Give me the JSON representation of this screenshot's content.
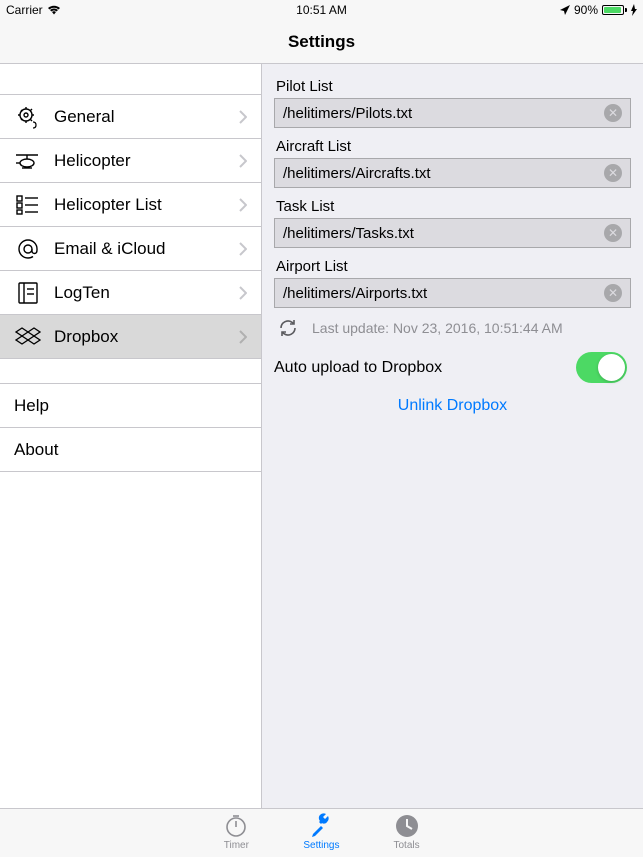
{
  "status": {
    "carrier": "Carrier",
    "time": "10:51 AM",
    "battery": "90%"
  },
  "nav": {
    "title": "Settings"
  },
  "sidebar": {
    "items": [
      {
        "label": "General"
      },
      {
        "label": "Helicopter"
      },
      {
        "label": "Helicopter List"
      },
      {
        "label": "Email & iCloud"
      },
      {
        "label": "LogTen"
      },
      {
        "label": "Dropbox"
      }
    ],
    "items2": [
      {
        "label": "Help"
      },
      {
        "label": "About"
      }
    ]
  },
  "detail": {
    "fields": [
      {
        "label": "Pilot List",
        "value": "/helitimers/Pilots.txt"
      },
      {
        "label": "Aircraft List",
        "value": "/helitimers/Aircrafts.txt"
      },
      {
        "label": "Task List",
        "value": "/helitimers/Tasks.txt"
      },
      {
        "label": "Airport List",
        "value": "/helitimers/Airports.txt"
      }
    ],
    "last_update": "Last update: Nov 23, 2016, 10:51:44 AM",
    "auto_upload": "Auto upload to Dropbox",
    "unlink": "Unlink Dropbox"
  },
  "tabs": [
    {
      "label": "Timer"
    },
    {
      "label": "Settings"
    },
    {
      "label": "Totals"
    }
  ]
}
